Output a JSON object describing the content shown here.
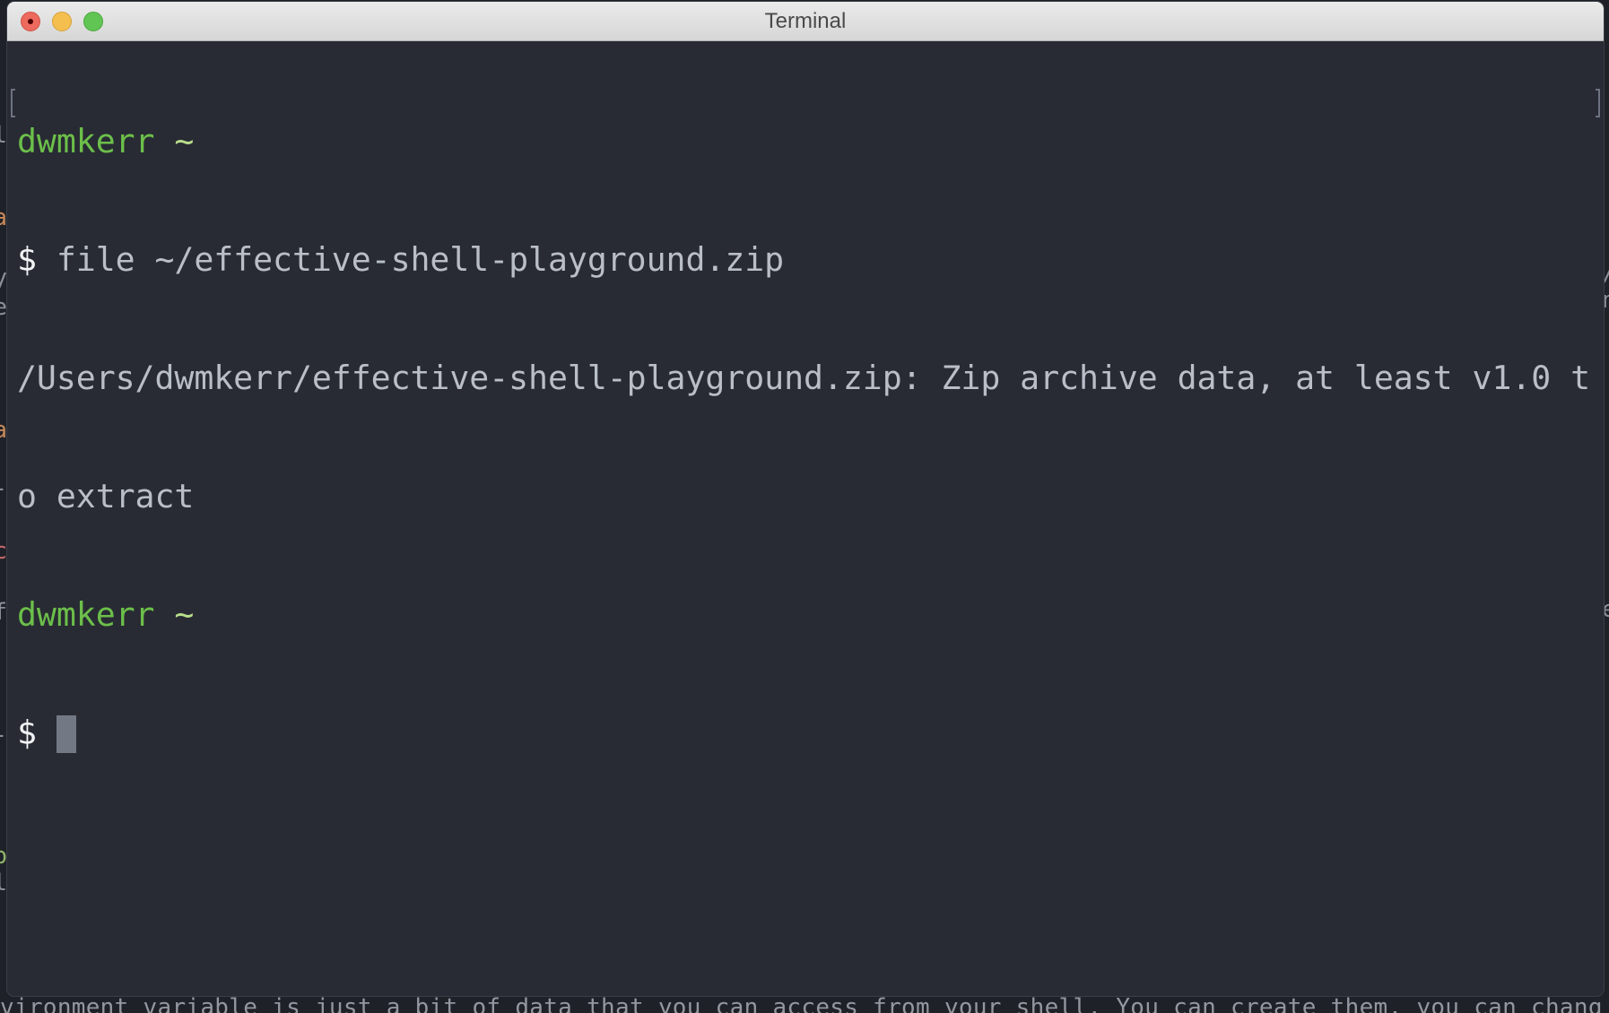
{
  "window": {
    "title": "Terminal",
    "buttons": {
      "close": "close-button",
      "minimize": "minimize-button",
      "zoom": "zoom-button"
    }
  },
  "terminal": {
    "lines": [
      {
        "type": "prompt",
        "user": "dwmkerr",
        "path": "~"
      },
      {
        "type": "command",
        "symbol": "$",
        "text": " file ~/effective-shell-playground.zip"
      },
      {
        "type": "output",
        "text": "/Users/dwmkerr/effective-shell-playground.zip: Zip archive data, at least v1.0 t"
      },
      {
        "type": "output",
        "text": "o extract"
      },
      {
        "type": "prompt",
        "user": "dwmkerr",
        "path": "~"
      },
      {
        "type": "command",
        "symbol": "$",
        "text": " "
      }
    ],
    "colors": {
      "background": "#282b33",
      "foreground": "#b9bec8",
      "user": "#6cbf4a",
      "path": "#b8de8c",
      "cursor": "#737885"
    }
  },
  "background": {
    "bottom_text": "vironment variable is just a bit of data that you can access from your shell. You can create them, you can chang",
    "left_fragments": [
      "l",
      "a",
      "y",
      "e",
      "a",
      "-",
      "c",
      "f",
      "-",
      "p",
      "l",
      "-"
    ],
    "right_fragments": [
      "/",
      "n",
      "e"
    ]
  }
}
